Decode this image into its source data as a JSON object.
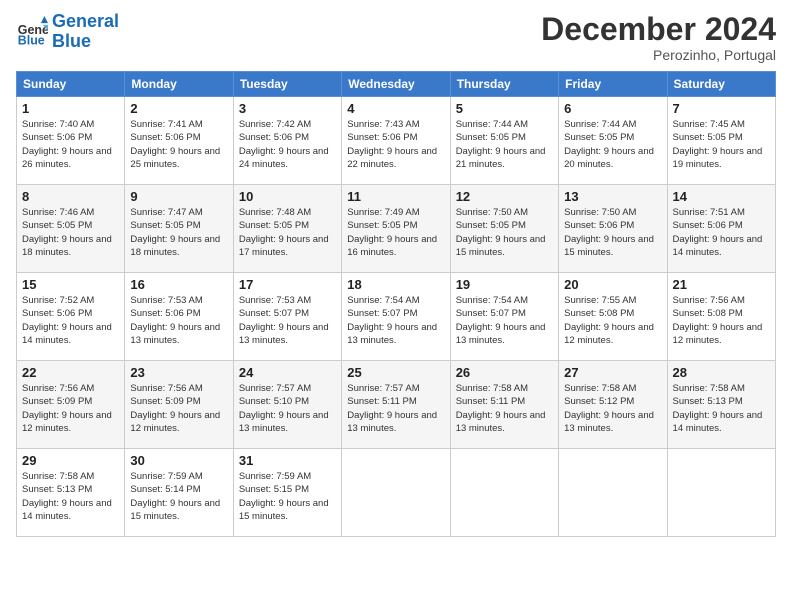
{
  "header": {
    "logo_line1": "General",
    "logo_line2": "Blue",
    "month": "December 2024",
    "location": "Perozinho, Portugal"
  },
  "weekdays": [
    "Sunday",
    "Monday",
    "Tuesday",
    "Wednesday",
    "Thursday",
    "Friday",
    "Saturday"
  ],
  "weeks": [
    [
      {
        "day": "1",
        "sunrise": "7:40 AM",
        "sunset": "5:06 PM",
        "daylight": "9 hours and 26 minutes."
      },
      {
        "day": "2",
        "sunrise": "7:41 AM",
        "sunset": "5:06 PM",
        "daylight": "9 hours and 25 minutes."
      },
      {
        "day": "3",
        "sunrise": "7:42 AM",
        "sunset": "5:06 PM",
        "daylight": "9 hours and 24 minutes."
      },
      {
        "day": "4",
        "sunrise": "7:43 AM",
        "sunset": "5:06 PM",
        "daylight": "9 hours and 22 minutes."
      },
      {
        "day": "5",
        "sunrise": "7:44 AM",
        "sunset": "5:05 PM",
        "daylight": "9 hours and 21 minutes."
      },
      {
        "day": "6",
        "sunrise": "7:44 AM",
        "sunset": "5:05 PM",
        "daylight": "9 hours and 20 minutes."
      },
      {
        "day": "7",
        "sunrise": "7:45 AM",
        "sunset": "5:05 PM",
        "daylight": "9 hours and 19 minutes."
      }
    ],
    [
      {
        "day": "8",
        "sunrise": "7:46 AM",
        "sunset": "5:05 PM",
        "daylight": "9 hours and 18 minutes."
      },
      {
        "day": "9",
        "sunrise": "7:47 AM",
        "sunset": "5:05 PM",
        "daylight": "9 hours and 18 minutes."
      },
      {
        "day": "10",
        "sunrise": "7:48 AM",
        "sunset": "5:05 PM",
        "daylight": "9 hours and 17 minutes."
      },
      {
        "day": "11",
        "sunrise": "7:49 AM",
        "sunset": "5:05 PM",
        "daylight": "9 hours and 16 minutes."
      },
      {
        "day": "12",
        "sunrise": "7:50 AM",
        "sunset": "5:05 PM",
        "daylight": "9 hours and 15 minutes."
      },
      {
        "day": "13",
        "sunrise": "7:50 AM",
        "sunset": "5:06 PM",
        "daylight": "9 hours and 15 minutes."
      },
      {
        "day": "14",
        "sunrise": "7:51 AM",
        "sunset": "5:06 PM",
        "daylight": "9 hours and 14 minutes."
      }
    ],
    [
      {
        "day": "15",
        "sunrise": "7:52 AM",
        "sunset": "5:06 PM",
        "daylight": "9 hours and 14 minutes."
      },
      {
        "day": "16",
        "sunrise": "7:53 AM",
        "sunset": "5:06 PM",
        "daylight": "9 hours and 13 minutes."
      },
      {
        "day": "17",
        "sunrise": "7:53 AM",
        "sunset": "5:07 PM",
        "daylight": "9 hours and 13 minutes."
      },
      {
        "day": "18",
        "sunrise": "7:54 AM",
        "sunset": "5:07 PM",
        "daylight": "9 hours and 13 minutes."
      },
      {
        "day": "19",
        "sunrise": "7:54 AM",
        "sunset": "5:07 PM",
        "daylight": "9 hours and 13 minutes."
      },
      {
        "day": "20",
        "sunrise": "7:55 AM",
        "sunset": "5:08 PM",
        "daylight": "9 hours and 12 minutes."
      },
      {
        "day": "21",
        "sunrise": "7:56 AM",
        "sunset": "5:08 PM",
        "daylight": "9 hours and 12 minutes."
      }
    ],
    [
      {
        "day": "22",
        "sunrise": "7:56 AM",
        "sunset": "5:09 PM",
        "daylight": "9 hours and 12 minutes."
      },
      {
        "day": "23",
        "sunrise": "7:56 AM",
        "sunset": "5:09 PM",
        "daylight": "9 hours and 12 minutes."
      },
      {
        "day": "24",
        "sunrise": "7:57 AM",
        "sunset": "5:10 PM",
        "daylight": "9 hours and 13 minutes."
      },
      {
        "day": "25",
        "sunrise": "7:57 AM",
        "sunset": "5:11 PM",
        "daylight": "9 hours and 13 minutes."
      },
      {
        "day": "26",
        "sunrise": "7:58 AM",
        "sunset": "5:11 PM",
        "daylight": "9 hours and 13 minutes."
      },
      {
        "day": "27",
        "sunrise": "7:58 AM",
        "sunset": "5:12 PM",
        "daylight": "9 hours and 13 minutes."
      },
      {
        "day": "28",
        "sunrise": "7:58 AM",
        "sunset": "5:13 PM",
        "daylight": "9 hours and 14 minutes."
      }
    ],
    [
      {
        "day": "29",
        "sunrise": "7:58 AM",
        "sunset": "5:13 PM",
        "daylight": "9 hours and 14 minutes."
      },
      {
        "day": "30",
        "sunrise": "7:59 AM",
        "sunset": "5:14 PM",
        "daylight": "9 hours and 15 minutes."
      },
      {
        "day": "31",
        "sunrise": "7:59 AM",
        "sunset": "5:15 PM",
        "daylight": "9 hours and 15 minutes."
      },
      null,
      null,
      null,
      null
    ]
  ]
}
